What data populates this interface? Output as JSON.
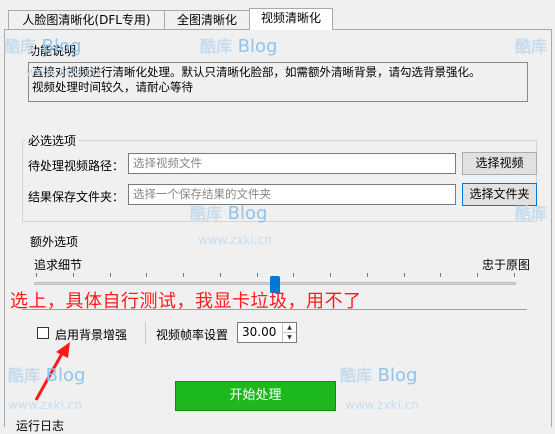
{
  "tabs": [
    {
      "label": "人脸图清晰化(DFL专用)",
      "active": false
    },
    {
      "label": "全图清晰化",
      "active": false
    },
    {
      "label": "视频清晰化",
      "active": true
    }
  ],
  "function_desc": {
    "title": "功能说明",
    "text_line1": "直接对视频进行清晰化处理。默认只清晰化脸部，如需额外清晰背景，请勾选背景强化。",
    "text_line2": "视频处理时间较久，请耐心等待"
  },
  "required": {
    "title": "必选选项",
    "video_path_label": "待处理视频路径：",
    "video_path_placeholder": "选择视频文件",
    "select_video_button": "选择视频",
    "output_folder_label": "结果保存文件夹：",
    "output_folder_placeholder": "选择一个保存结果的文件夹",
    "select_folder_button": "选择文件夹"
  },
  "extra": {
    "title": "额外选项",
    "slider_left_label": "追求细节",
    "slider_right_label": "忠于原图",
    "slider_fraction": 0.5,
    "slider_ticks": 14,
    "bg_enhance_label": "启用背景增强",
    "bg_enhance_checked": false,
    "fps_label": "视频帧率设置",
    "fps_value": "30.00"
  },
  "annotation_text": "选上，具体自行测试，我显卡垃圾，用不了",
  "start_button": "开始处理",
  "log_title": "运行日志",
  "watermark": {
    "brand_cn": "酷库",
    "brand_en": "Blog",
    "url": "www.zxki.cn"
  },
  "colors": {
    "start_button": "#1cb81c",
    "annotation": "#ff1a1a",
    "slider_thumb": "#0078d7"
  }
}
